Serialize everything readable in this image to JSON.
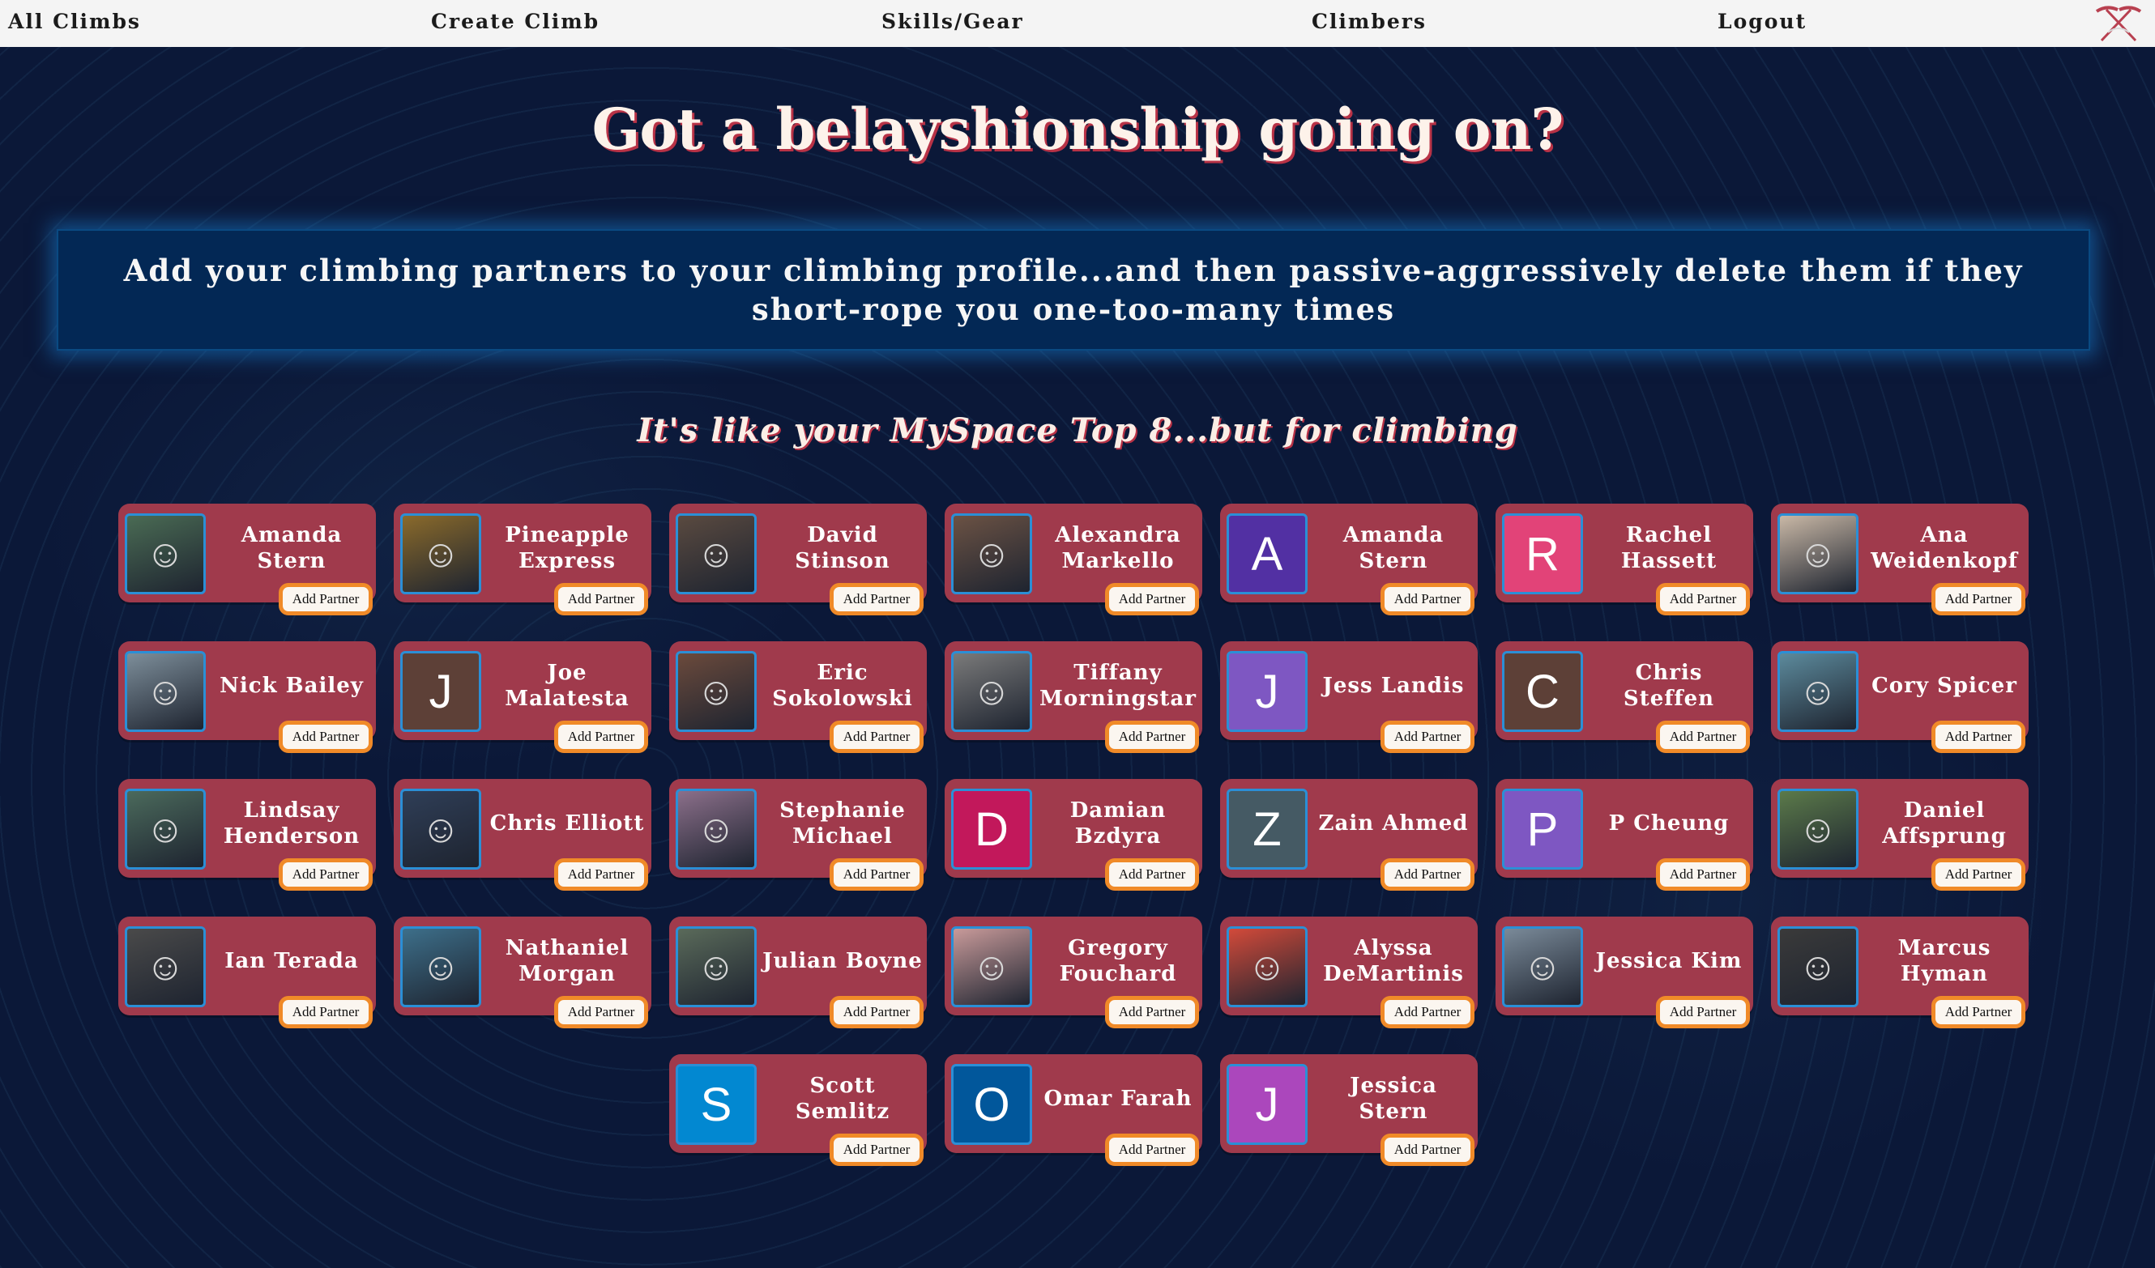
{
  "nav": {
    "items": [
      {
        "label": "All Climbs"
      },
      {
        "label": "Create Climb"
      },
      {
        "label": "Skills/Gear"
      },
      {
        "label": "Climbers"
      },
      {
        "label": "Logout"
      }
    ],
    "logo_icon": "ice-axes-logo-icon"
  },
  "headline": "Got a belayshionship going on?",
  "banner_text": "Add your climbing partners to your climbing profile...and then passive-aggressively delete them if they short-rope you one-too-many times",
  "subhead": "It's like your MySpace Top 8...but for climbing",
  "add_label": "Add Partner",
  "climbers": [
    {
      "name": "Amanda Stern",
      "initial": "",
      "color": "#4a6b54"
    },
    {
      "name": "Pineapple Express",
      "initial": "",
      "color": "#8a6a2b"
    },
    {
      "name": "David Stinson",
      "initial": "",
      "color": "#5a4a40"
    },
    {
      "name": "Alexandra Markello",
      "initial": "",
      "color": "#6b5244"
    },
    {
      "name": "Amanda Stern",
      "initial": "A",
      "color": "#5230a3"
    },
    {
      "name": "Rachel Hassett",
      "initial": "R",
      "color": "#e24378"
    },
    {
      "name": "Ana Weidenkopf",
      "initial": "",
      "color": "#c9b8a6"
    },
    {
      "name": "Nick Bailey",
      "initial": "",
      "color": "#7d8e9a"
    },
    {
      "name": "Joe Malatesta",
      "initial": "J",
      "color": "#5d4037"
    },
    {
      "name": "Eric Sokolowski",
      "initial": "",
      "color": "#6b4a3c"
    },
    {
      "name": "Tiffany Morningstar",
      "initial": "",
      "color": "#7a7a7a"
    },
    {
      "name": "Jess Landis",
      "initial": "J",
      "color": "#7e57c2"
    },
    {
      "name": "Chris Steffen",
      "initial": "C",
      "color": "#5d4037"
    },
    {
      "name": "Cory Spicer",
      "initial": "",
      "color": "#5c8a9c"
    },
    {
      "name": "Lindsay Henderson",
      "initial": "",
      "color": "#4b6a5c"
    },
    {
      "name": "Chris Elliott",
      "initial": "",
      "color": "#2f3e57"
    },
    {
      "name": "Stephanie Michael",
      "initial": "",
      "color": "#8b6f8a"
    },
    {
      "name": "Damian Bzdyra",
      "initial": "D",
      "color": "#c2185b"
    },
    {
      "name": "Zain Ahmed",
      "initial": "Z",
      "color": "#455a64"
    },
    {
      "name": "P Cheung",
      "initial": "P",
      "color": "#7e57c2"
    },
    {
      "name": "Daniel Affsprung",
      "initial": "",
      "color": "#5b7a4a"
    },
    {
      "name": "Ian Terada",
      "initial": "",
      "color": "#4a4a4a"
    },
    {
      "name": "Nathaniel Morgan",
      "initial": "",
      "color": "#3d6f8a"
    },
    {
      "name": "Julian Boyne",
      "initial": "",
      "color": "#5a6a5a"
    },
    {
      "name": "Gregory Fouchard",
      "initial": "",
      "color": "#c89a9a"
    },
    {
      "name": "Alyssa DeMartinis",
      "initial": "",
      "color": "#d24a3a"
    },
    {
      "name": "Jessica Kim",
      "initial": "",
      "color": "#7a8a99"
    },
    {
      "name": "Marcus Hyman",
      "initial": "",
      "color": "#3a3a3a"
    },
    {
      "name": "Scott Semlitz",
      "initial": "S",
      "color": "#0288d1"
    },
    {
      "name": "Omar Farah",
      "initial": "O",
      "color": "#01579b"
    },
    {
      "name": "Jessica Stern",
      "initial": "J",
      "color": "#ab47bc"
    }
  ]
}
